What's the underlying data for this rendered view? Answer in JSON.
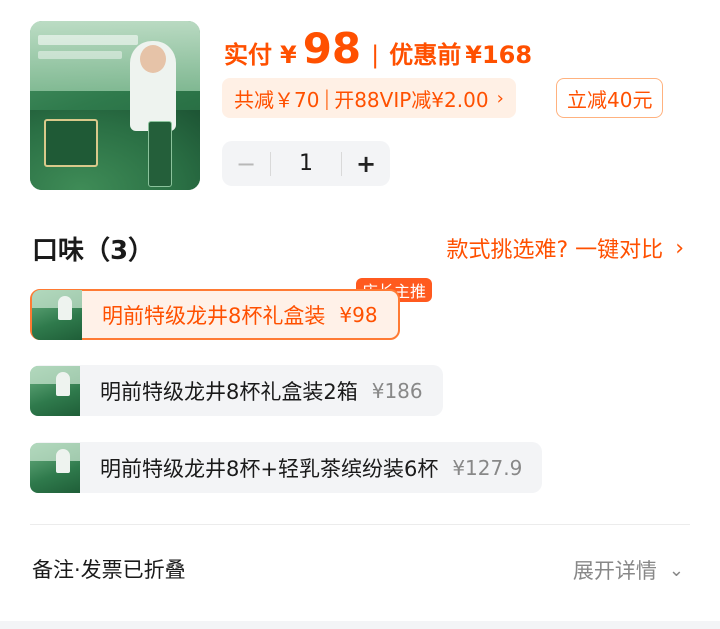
{
  "product": {
    "image_icon": "tea-gift-box-image",
    "price_label": "实付",
    "price_yen": "¥",
    "price_value": "98",
    "separator": "|",
    "original_label": "优惠前",
    "original_value": "¥168"
  },
  "discount": {
    "total": "共减￥70",
    "divider": "|",
    "vip": "开88VIP减¥2.00",
    "chevron_icon": "chevron-right-icon",
    "instant": "立减40元"
  },
  "quantity": {
    "minus": "−",
    "value": "1",
    "plus": "+"
  },
  "flavor": {
    "title": "口味（3）",
    "compare_link": "款式挑选难? 一键对比",
    "compare_chevron": "›",
    "badge": "店长主推",
    "options": [
      {
        "name": "明前特级龙井8杯礼盒装",
        "price": "¥98",
        "selected": true
      },
      {
        "name": "明前特级龙井8杯礼盒装2箱",
        "price": "¥186",
        "selected": false
      },
      {
        "name": "明前特级龙井8杯+轻乳茶缤纷装6杯",
        "price": "¥127.9",
        "selected": false
      }
    ]
  },
  "footer": {
    "note": "备注·发票已折叠",
    "expand": "展开详情",
    "expand_chevron": "⌄"
  },
  "colors": {
    "accent": "#ff5000",
    "accent_bg": "#fff0e5",
    "neutral_bg": "#f3f4f6"
  }
}
